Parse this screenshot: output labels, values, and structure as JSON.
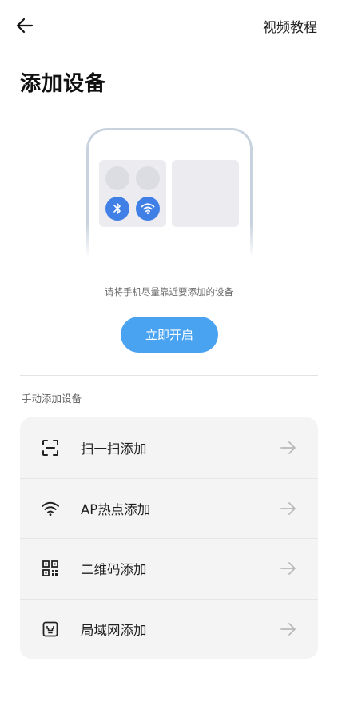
{
  "header": {
    "back_icon": "arrow-left-icon",
    "video_link": "视频教程"
  },
  "title": "添加设备",
  "illustration": {
    "icons": [
      "bluetooth-icon",
      "wifi-icon"
    ],
    "accent": "#3f7fe6"
  },
  "hint": "请将手机尽量靠近要添加的设备",
  "enable_button": "立即开启",
  "manual": {
    "section_label": "手动添加设备",
    "items": [
      {
        "label": "扫一扫添加",
        "icon": "scan-icon"
      },
      {
        "label": "AP热点添加",
        "icon": "wifi-icon"
      },
      {
        "label": "二维码添加",
        "icon": "qr-code-icon"
      },
      {
        "label": "局域网添加",
        "icon": "lan-port-icon"
      }
    ],
    "arrow_icon": "arrow-right-icon"
  },
  "colors": {
    "primary_button": "#4aa3f0",
    "list_background": "#f4f4f4"
  }
}
